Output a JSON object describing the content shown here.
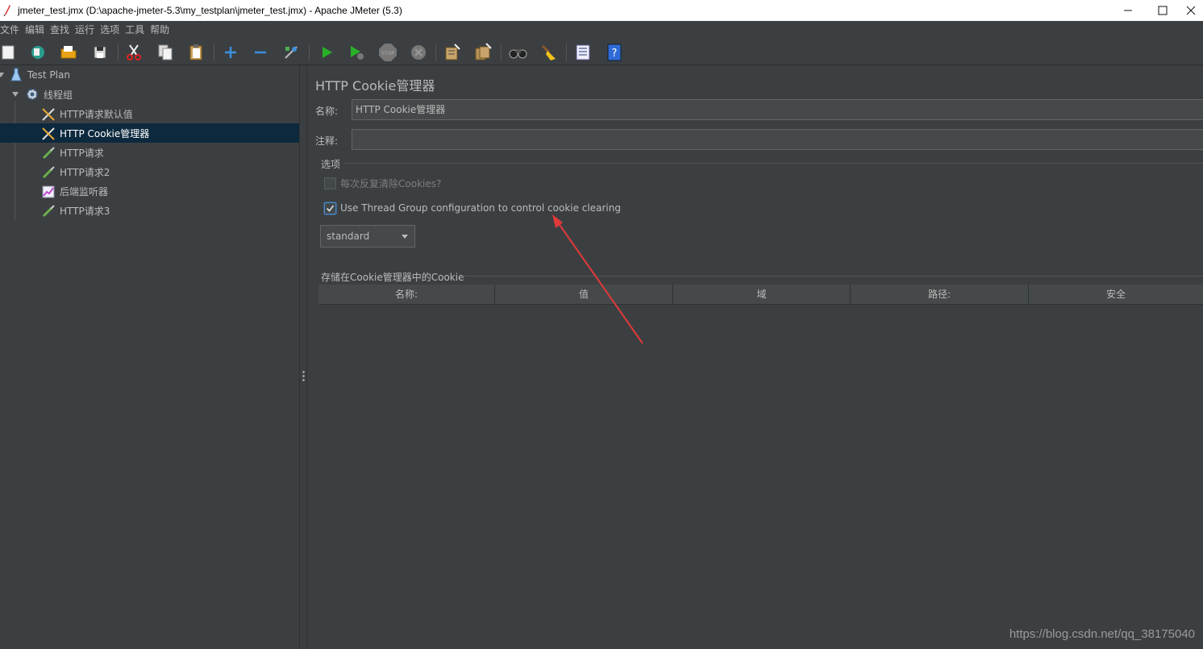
{
  "window": {
    "title": "jmeter_test.jmx (D:\\apache-jmeter-5.3\\my_testplan\\jmeter_test.jmx) - Apache JMeter (5.3)",
    "controls": [
      "minimize",
      "maximize",
      "close"
    ]
  },
  "menubar": [
    "文件",
    "编辑",
    "查找",
    "运行",
    "选项",
    "工具",
    "帮助"
  ],
  "toolbar": {
    "buttons": [
      "new-icon",
      "templates-icon",
      "open-icon",
      "save-icon",
      "cut-icon",
      "copy-icon",
      "paste-icon",
      "expand-icon",
      "collapse-icon",
      "toggle-icon",
      "start-icon",
      "start-no-pause-icon",
      "stop-icon",
      "shutdown-icon",
      "clear-icon",
      "clear-all-icon",
      "search-icon",
      "reset-search-icon",
      "function-helper-icon",
      "help-icon"
    ]
  },
  "tree": {
    "items": [
      {
        "label": "Test Plan",
        "icon": "flask-icon"
      },
      {
        "label": "线程组",
        "icon": "gear-icon"
      },
      {
        "label": "HTTP请求默认值",
        "icon": "tools-icon"
      },
      {
        "label": "HTTP Cookie管理器",
        "icon": "tools-icon"
      },
      {
        "label": "HTTP请求",
        "icon": "pipette-icon"
      },
      {
        "label": "HTTP请求2",
        "icon": "pipette-icon"
      },
      {
        "label": "后端监听器",
        "icon": "chart-icon"
      },
      {
        "label": "HTTP请求3",
        "icon": "pipette-icon"
      }
    ],
    "selected": "HTTP Cookie管理器"
  },
  "panel": {
    "title": "HTTP Cookie管理器",
    "name_label": "名称:",
    "name_value": "HTTP Cookie管理器",
    "comment_label": "注释:",
    "comment_value": "",
    "options_title": "选项",
    "clear_each_iteration_label": "每次反复清除Cookies?",
    "clear_each_iteration_checked": false,
    "use_thread_group_label": "Use Thread Group configuration to control cookie clearing",
    "use_thread_group_checked": true,
    "cookie_policy": "standard",
    "stored_cookies_title": "存储在Cookie管理器中的Cookie",
    "table_columns": [
      "名称:",
      "值",
      "域",
      "路径:",
      "安全"
    ]
  },
  "colors": {
    "background": "#3c3f41",
    "selection": "#0d293e",
    "annotation_arrow": "#e03a3a"
  },
  "watermark": "https://blog.csdn.net/qq_38175040"
}
